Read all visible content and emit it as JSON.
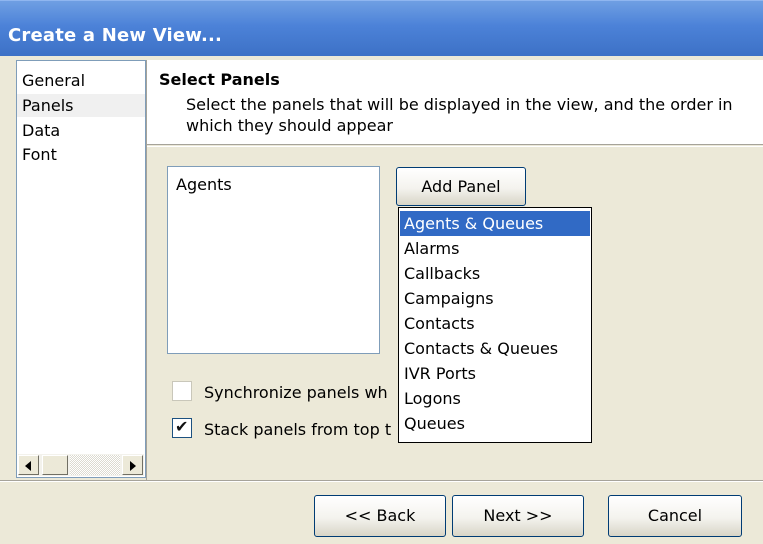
{
  "window": {
    "title": "Create a New View..."
  },
  "nav": {
    "items": [
      {
        "label": "General"
      },
      {
        "label": "Panels"
      },
      {
        "label": "Data"
      },
      {
        "label": "Font"
      }
    ],
    "selected": "Panels"
  },
  "section": {
    "title": "Select Panels",
    "description": "Select the panels that will be displayed in the view, and the order in which they should appear"
  },
  "panel_list": {
    "items": [
      "Agents"
    ]
  },
  "add_panel_button": "Add Panel",
  "dropdown": {
    "items": [
      "Agents & Queues",
      "Alarms",
      "Callbacks",
      "Campaigns",
      "Contacts",
      "Contacts & Queues",
      "IVR Ports",
      "Logons",
      "Queues"
    ],
    "highlighted": "Agents & Queues"
  },
  "options": {
    "sync_label": "Synchronize panels wh",
    "sync_checked": false,
    "stack_label": "Stack panels from top t",
    "stack_checked": true
  },
  "footer": {
    "back": "<< Back",
    "next": "Next >>",
    "cancel": "Cancel"
  }
}
